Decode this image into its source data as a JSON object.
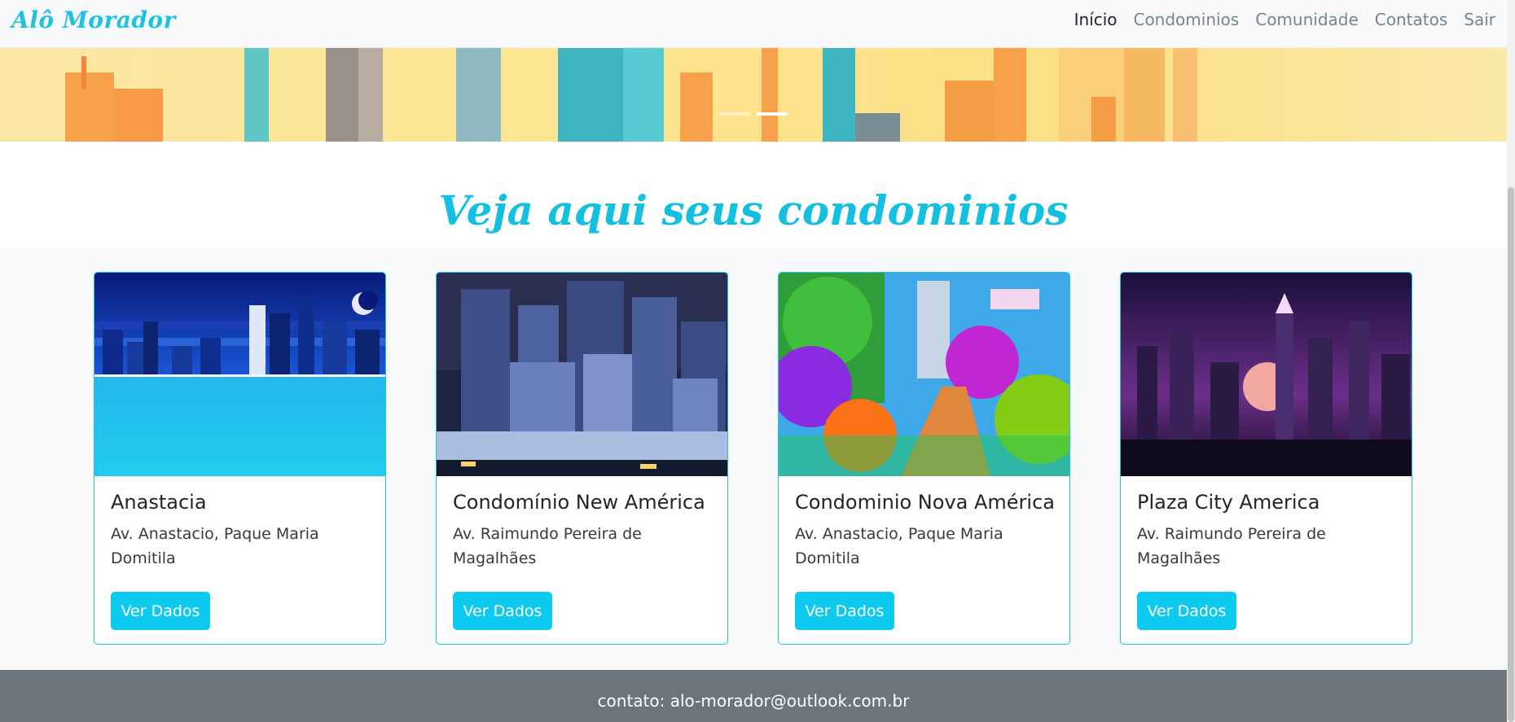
{
  "navbar": {
    "brand": "Alô Morador",
    "links": [
      {
        "label": "Início",
        "active": true
      },
      {
        "label": "Condominios"
      },
      {
        "label": "Comunidade"
      },
      {
        "label": "Contatos"
      },
      {
        "label": "Sair"
      }
    ]
  },
  "hero": {
    "indicators": 2,
    "active_indicator": 1
  },
  "section": {
    "title": "Veja aqui seus condominios"
  },
  "cards": [
    {
      "title": "Anastacia",
      "address": "Av. Anastacio, Paque Maria Domitila",
      "button": "Ver Dados",
      "image": "pixel-night-city-reflection"
    },
    {
      "title": "Condomínio New América",
      "address": "Av. Raimundo Pereira de Magalhães",
      "button": "Ver Dados",
      "image": "pixel-blue-city-buildings"
    },
    {
      "title": "Condominio Nova América",
      "address": "Av. Anastacio, Paque Maria Domitila",
      "button": "Ver Dados",
      "image": "pixel-colorful-garden"
    },
    {
      "title": "Plaza City America",
      "address": "Av. Raimundo Pereira de Magalhães",
      "button": "Ver Dados",
      "image": "pixel-purple-night-skyline"
    }
  ],
  "footer": {
    "contact": "contato: alo-morador@outlook.com.br"
  },
  "colors": {
    "accent": "#0dcaf0",
    "brand": "#1cc2e0",
    "footer": "#6c757d",
    "navbar_bg": "#f8f9fa"
  }
}
